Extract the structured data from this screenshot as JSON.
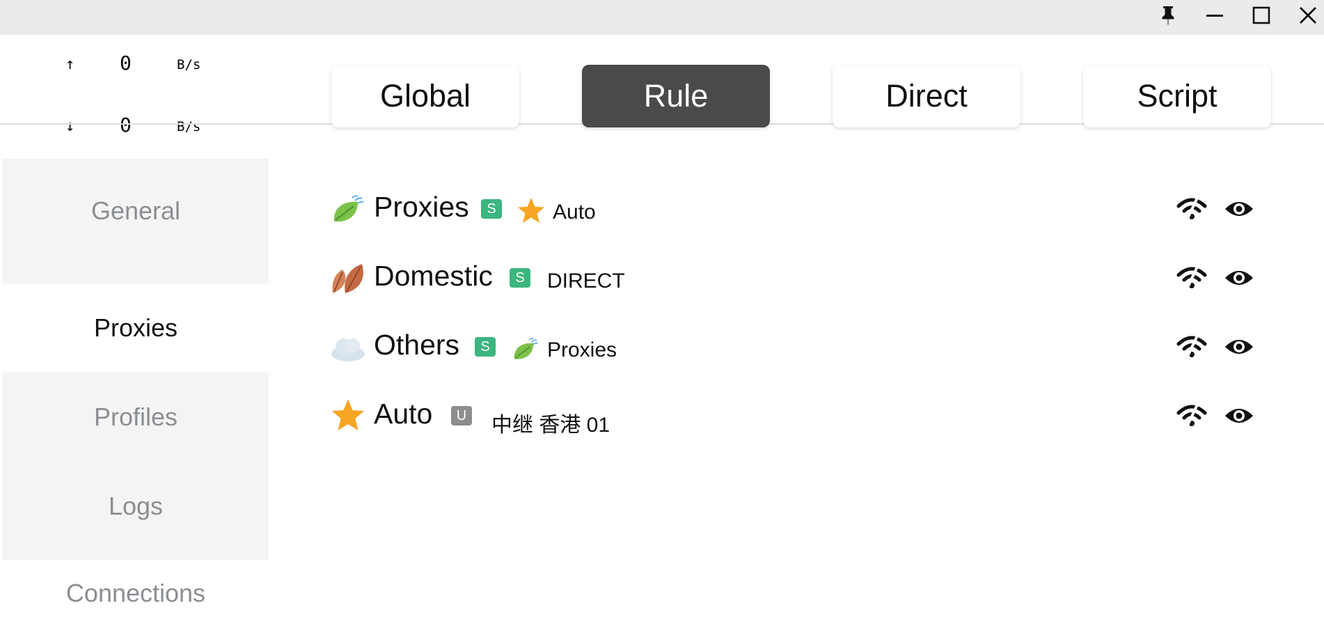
{
  "window": {
    "controls": [
      {
        "name": "pin-icon"
      },
      {
        "name": "minimize-icon"
      },
      {
        "name": "maximize-icon"
      },
      {
        "name": "close-icon"
      }
    ]
  },
  "traffic": {
    "upload": {
      "arrow": "↑",
      "value": "0",
      "unit": "B/s"
    },
    "download": {
      "arrow": "↓",
      "value": "0",
      "unit": "B/s"
    }
  },
  "sidebar": {
    "items": [
      {
        "label": "General"
      },
      {
        "label": "Proxies",
        "active": true
      },
      {
        "label": "Profiles"
      },
      {
        "label": "Logs"
      },
      {
        "label": "Connections"
      }
    ]
  },
  "modes": [
    {
      "label": "Global"
    },
    {
      "label": "Rule",
      "active": true
    },
    {
      "label": "Direct"
    },
    {
      "label": "Script"
    }
  ],
  "groups": [
    {
      "icon": "leaf-fluttering-icon",
      "name": "Proxies",
      "badge": "S",
      "selected_icon": "star-icon",
      "selected": "Auto"
    },
    {
      "icon": "fallen-leaves-icon",
      "name": "Domestic",
      "badge": "S",
      "selected": "DIRECT"
    },
    {
      "icon": "cloud-icon",
      "name": "Others",
      "badge": "S",
      "selected_icon": "leaf-fluttering-icon",
      "selected": "Proxies"
    },
    {
      "icon": "star-icon",
      "name": "Auto",
      "badge": "U",
      "selected": "中继 香港 01"
    }
  ],
  "colors": {
    "accent_active": "#4a4a4a",
    "badge_s": "#3cb57e",
    "badge_u": "#8d8d8d",
    "star": "#f6a623",
    "leaf": "#7cc24a"
  }
}
